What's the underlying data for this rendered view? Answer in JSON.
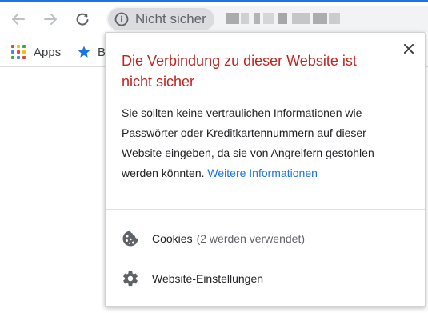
{
  "colors": {
    "accent": "#1a73e8",
    "warning_title": "#c5221f",
    "link": "#1a73e8",
    "chip_bg": "#dadce0",
    "omnibox_bg": "#f1f3f4"
  },
  "toolbar": {
    "back_icon": "arrow-left-icon",
    "forward_icon": "arrow-right-icon",
    "reload_icon": "reload-icon",
    "security_chip_icon": "info-icon",
    "security_chip_label": "Nicht sicher"
  },
  "bookmarks": {
    "apps_label": "Apps",
    "apps_icon": "apps-grid-icon",
    "apps_grid_colors": [
      "#ea4335",
      "#fbbc04",
      "#34a853",
      "#4285f4",
      "#ea4335",
      "#fbbc04",
      "#34a853",
      "#4285f4",
      "#ea4335"
    ],
    "star_icon": "star-icon",
    "star_label": "B"
  },
  "popup": {
    "close_icon": "close-icon",
    "title": "Die Verbindung zu dieser Website ist nicht sicher",
    "body": "Sie sollten keine vertraulichen Informationen wie Passwörter oder Kreditkartennummern auf dieser Website eingeben, da sie von Angreifern gestohlen werden könnten.",
    "more_link": "Weitere Informationen",
    "cookies": {
      "icon": "cookie-icon",
      "label": "Cookies",
      "sub": "(2 werden verwendet)"
    },
    "site_settings": {
      "icon": "gear-icon",
      "label": "Website-Einstellungen"
    }
  }
}
